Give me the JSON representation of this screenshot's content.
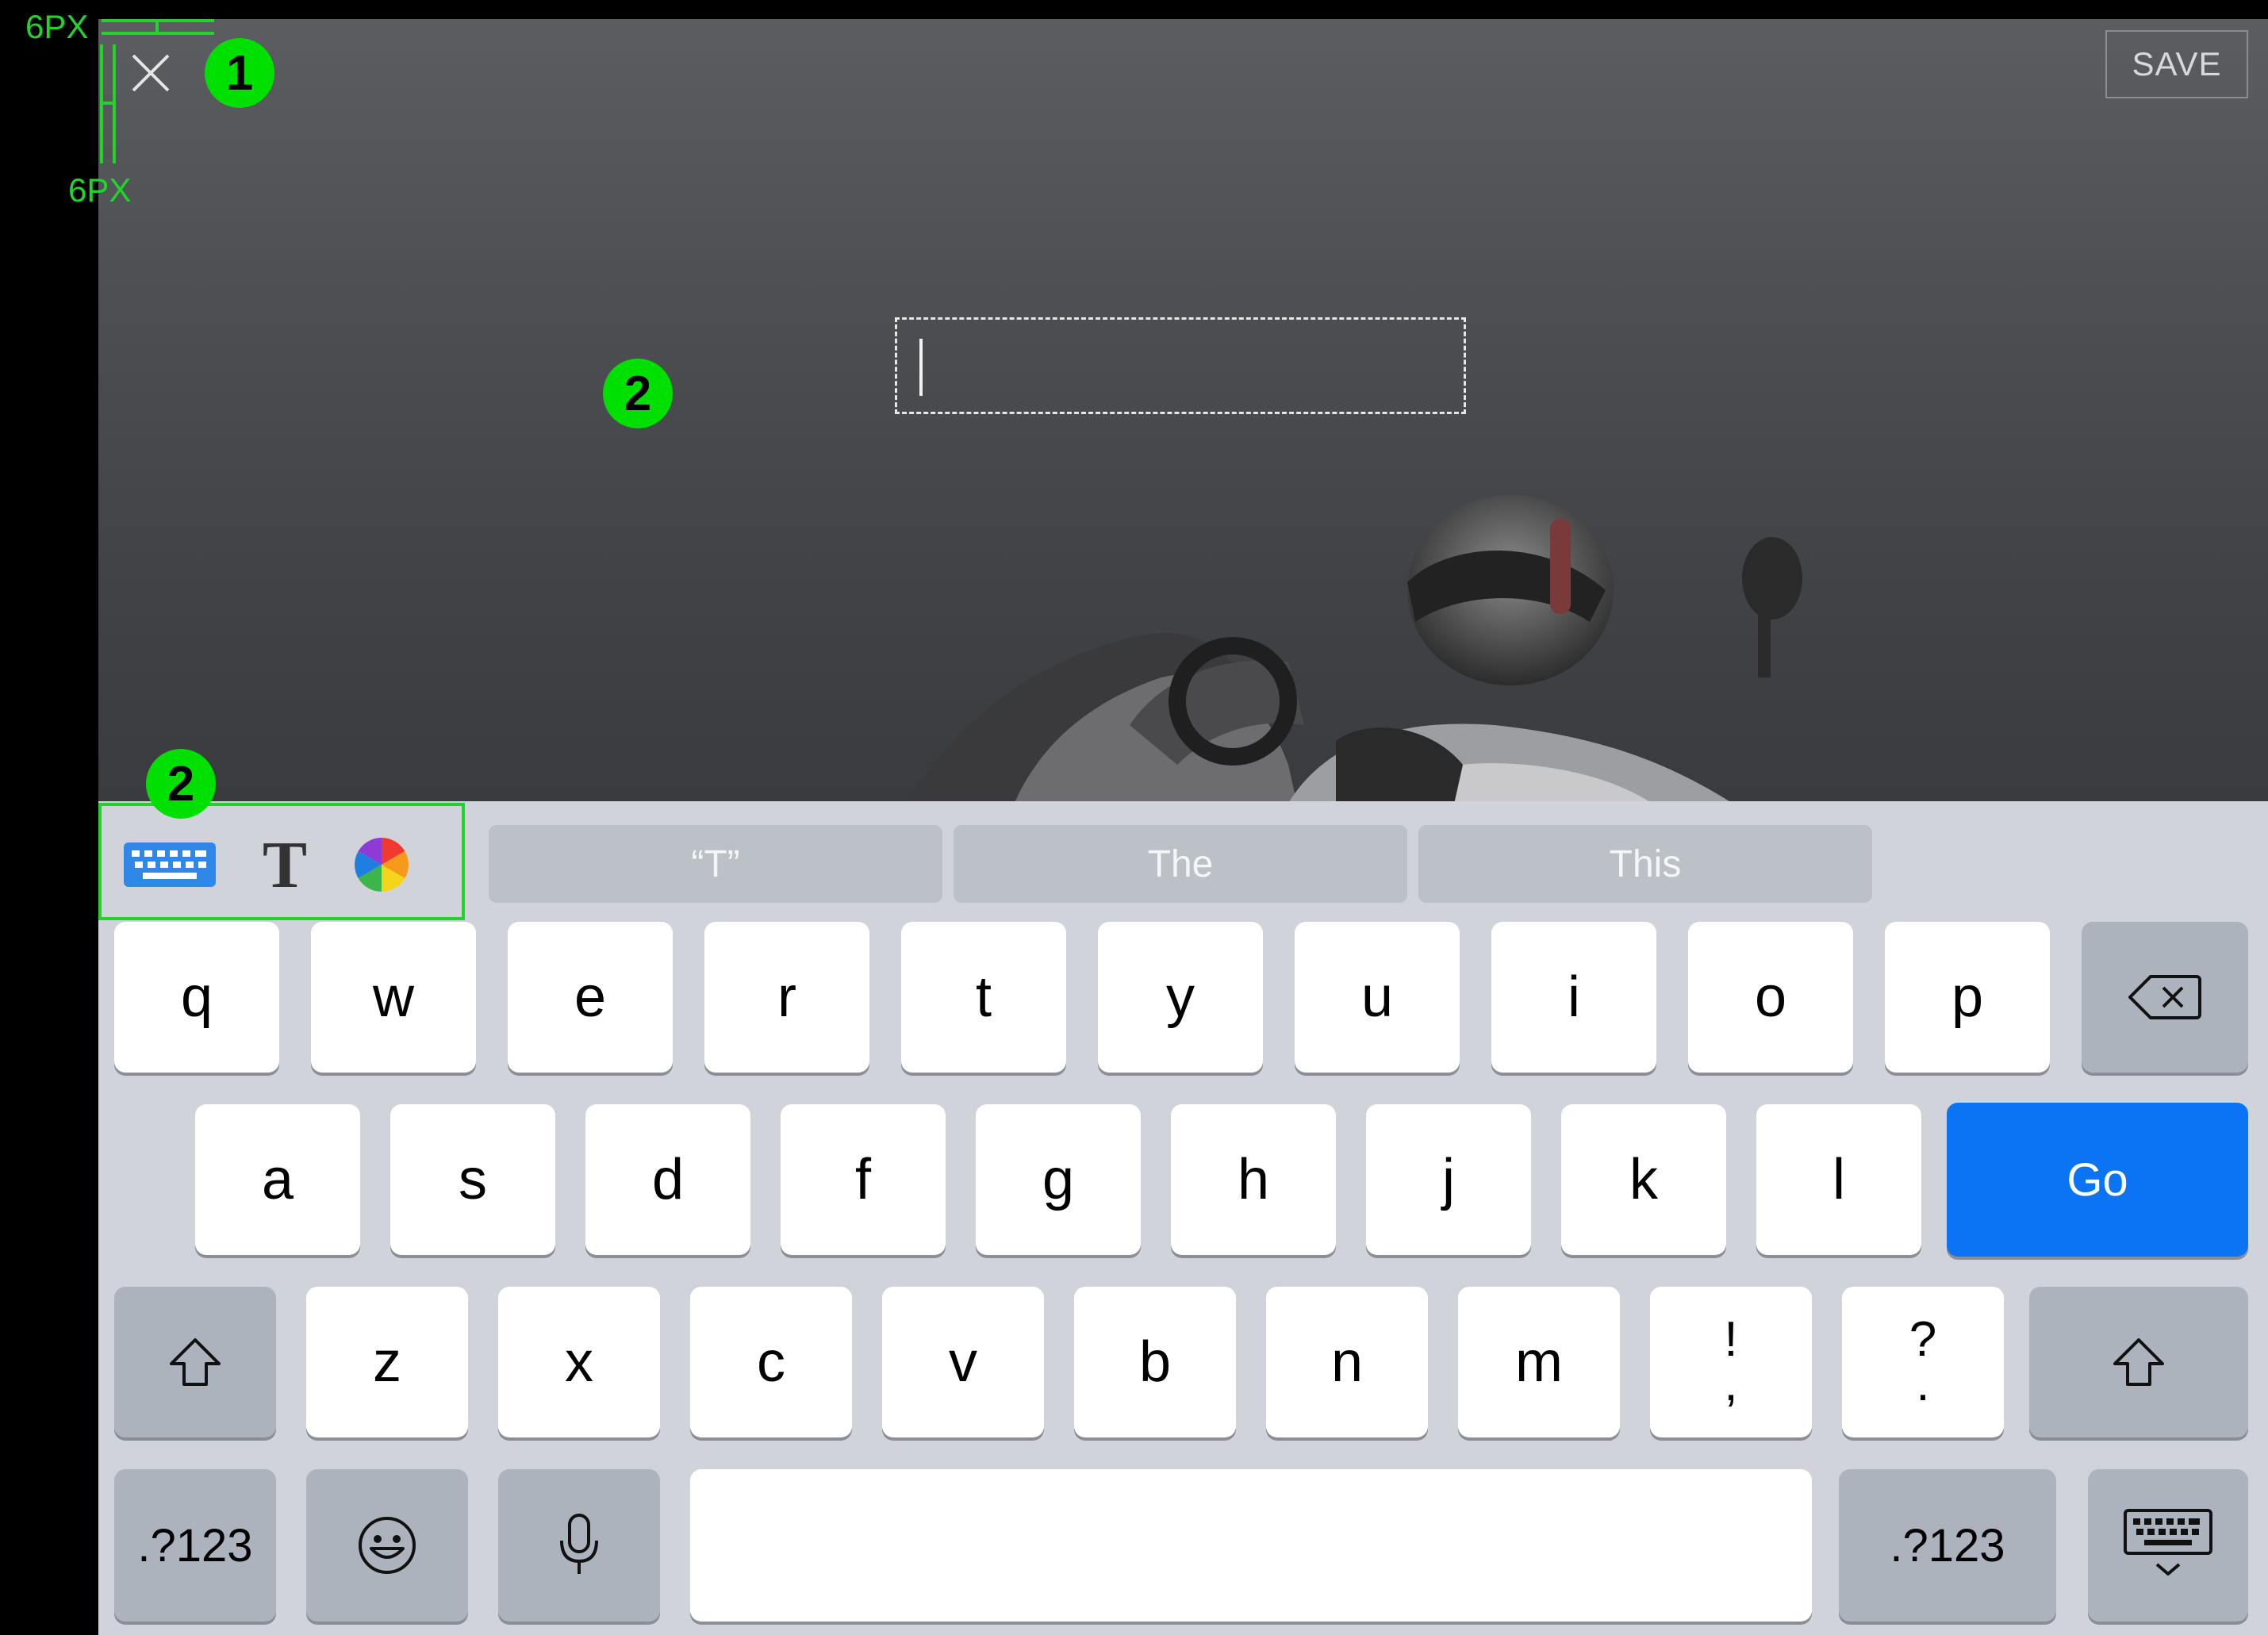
{
  "annotations": {
    "spacing_label_top": "6PX",
    "spacing_label_left": "6PX",
    "badge_1": "1",
    "badge_2_canvas": "2",
    "badge_2_toolbar": "2",
    "color": "#00e000"
  },
  "editor": {
    "save_label": "SAVE",
    "text_value": "",
    "close_icon": "close-icon"
  },
  "toolbar": {
    "keyboard_icon": "keyboard-icon",
    "font_icon_label": "T",
    "color_picker_icon": "color-wheel-icon"
  },
  "suggestions": [
    "“T”",
    "The",
    "This"
  ],
  "keyboard": {
    "row1": [
      "q",
      "w",
      "e",
      "r",
      "t",
      "y",
      "u",
      "i",
      "o",
      "p"
    ],
    "row2": [
      "a",
      "s",
      "d",
      "f",
      "g",
      "h",
      "j",
      "k",
      "l"
    ],
    "row3": [
      "z",
      "x",
      "c",
      "v",
      "b",
      "n",
      "m"
    ],
    "punct1": {
      "top": "!",
      "bottom": ","
    },
    "punct2": {
      "top": "?",
      "bottom": "."
    },
    "go_label": "Go",
    "numbers_label_left": ".?123",
    "numbers_label_right": ".?123",
    "accent_color": "#0a74f5"
  }
}
